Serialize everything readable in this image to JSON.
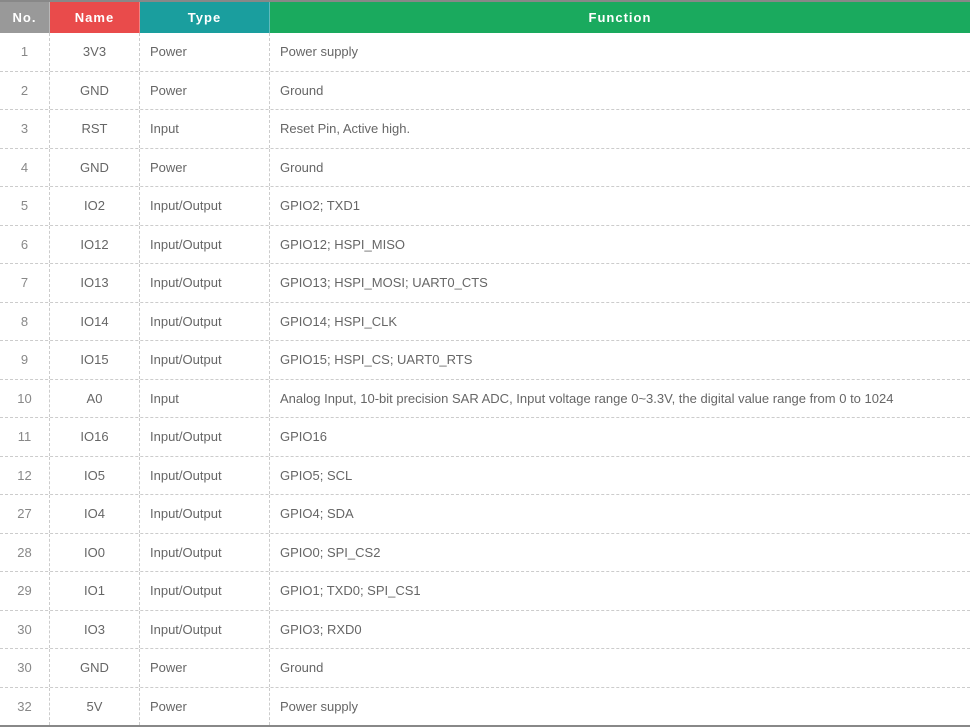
{
  "headers": {
    "no": "No.",
    "name": "Name",
    "type": "Type",
    "function": "Function"
  },
  "rows": [
    {
      "no": "1",
      "name": "3V3",
      "type": "Power",
      "function": "Power supply"
    },
    {
      "no": "2",
      "name": "GND",
      "type": "Power",
      "function": "Ground"
    },
    {
      "no": "3",
      "name": "RST",
      "type": "Input",
      "function": "Reset Pin, Active high."
    },
    {
      "no": "4",
      "name": "GND",
      "type": "Power",
      "function": "Ground"
    },
    {
      "no": "5",
      "name": "IO2",
      "type": "Input/Output",
      "function": "GPIO2; TXD1"
    },
    {
      "no": "6",
      "name": "IO12",
      "type": "Input/Output",
      "function": "GPIO12; HSPI_MISO"
    },
    {
      "no": "7",
      "name": "IO13",
      "type": "Input/Output",
      "function": "GPIO13; HSPI_MOSI; UART0_CTS"
    },
    {
      "no": "8",
      "name": "IO14",
      "type": "Input/Output",
      "function": "GPIO14; HSPI_CLK"
    },
    {
      "no": "9",
      "name": "IO15",
      "type": "Input/Output",
      "function": "GPIO15; HSPI_CS; UART0_RTS"
    },
    {
      "no": "10",
      "name": "A0",
      "type": "Input",
      "function": "Analog Input, 10-bit precision SAR ADC, Input voltage range 0~3.3V, the digital value range from 0 to 1024"
    },
    {
      "no": "11",
      "name": "IO16",
      "type": "Input/Output",
      "function": "GPIO16"
    },
    {
      "no": "12",
      "name": "IO5",
      "type": "Input/Output",
      "function": "GPIO5; SCL"
    },
    {
      "no": "27",
      "name": "IO4",
      "type": "Input/Output",
      "function": "GPIO4; SDA"
    },
    {
      "no": "28",
      "name": "IO0",
      "type": "Input/Output",
      "function": "GPIO0; SPI_CS2"
    },
    {
      "no": "29",
      "name": "IO1",
      "type": "Input/Output",
      "function": "GPIO1; TXD0; SPI_CS1"
    },
    {
      "no": "30",
      "name": "IO3",
      "type": "Input/Output",
      "function": "GPIO3; RXD0"
    },
    {
      "no": "30",
      "name": "GND",
      "type": "Power",
      "function": "Ground"
    },
    {
      "no": "32",
      "name": "5V",
      "type": "Power",
      "function": "Power supply"
    }
  ]
}
